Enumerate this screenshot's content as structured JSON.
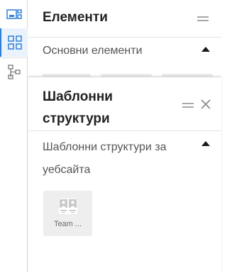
{
  "toolbar": {
    "tools": [
      {
        "icon": "widget-preview-icon",
        "active": false
      },
      {
        "icon": "grid-icon",
        "active": true
      },
      {
        "icon": "tree-structure-icon",
        "active": false
      }
    ],
    "accent_color": "#2f7fd8"
  },
  "elements_panel": {
    "title": "Елементи",
    "section_label": "Основни елементи",
    "expanded": true
  },
  "templates_panel": {
    "title": "Шаблонни структури",
    "section_label": "Шаблонни структури за уебсайта",
    "expanded": true,
    "items": [
      {
        "label": "Team ...",
        "icon": "team-template-thumbnail-icon"
      }
    ]
  }
}
